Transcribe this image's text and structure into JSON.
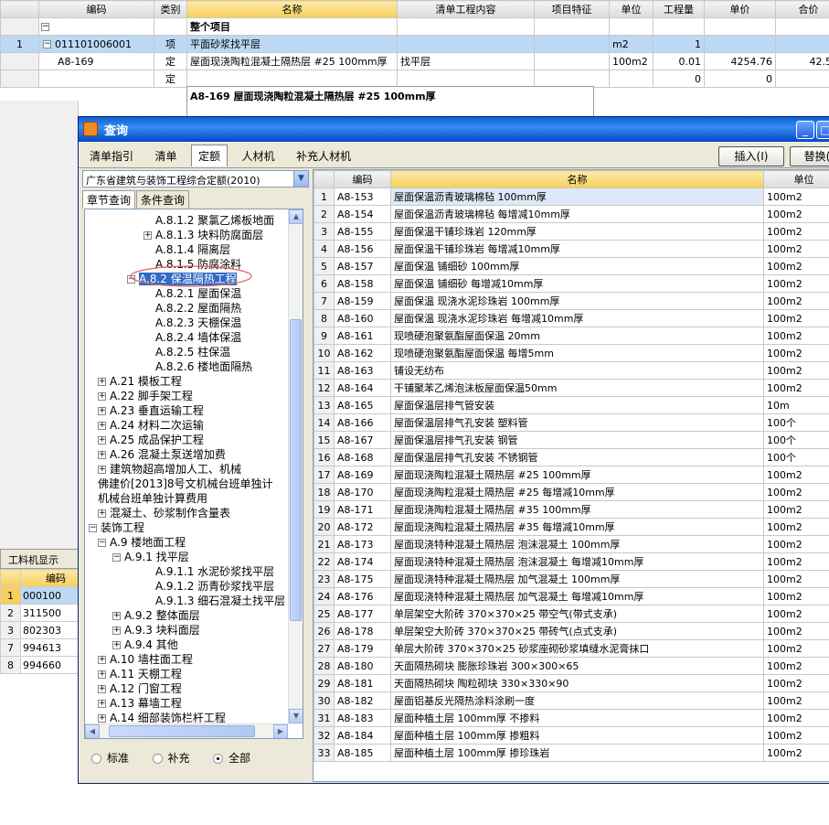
{
  "main_grid": {
    "headers": [
      "编码",
      "类别",
      "名称",
      "清单工程内容",
      "项目特征",
      "单位",
      "工程量",
      "单价",
      "合价"
    ],
    "rows": [
      {
        "rn": "",
        "expand": "−",
        "code": "",
        "type": "",
        "name": "整个项目",
        "content": "",
        "feature": "",
        "unit": "",
        "qty": "",
        "price": "",
        "total": ""
      },
      {
        "rn": "1",
        "expand": "−",
        "code": "011101006001",
        "type": "项",
        "name": "平面砂浆找平层",
        "content": "",
        "feature": "",
        "unit": "m2",
        "qty": "1",
        "price": "",
        "total": ""
      },
      {
        "rn": "",
        "expand": "",
        "code": "A8-169",
        "type": "定",
        "name": "屋面现浇陶粒混凝土隔热层 #25 100mm厚",
        "content": "找平层",
        "feature": "",
        "unit": "100m2",
        "qty": "0.01",
        "price": "4254.76",
        "total": "42.55"
      },
      {
        "rn": "",
        "expand": "",
        "code": "",
        "type": "定",
        "name": "",
        "content": "",
        "feature": "",
        "unit": "",
        "qty": "0",
        "price": "0",
        "total": "0"
      }
    ],
    "tooltip": "A8-169 屋面现浇陶粒混凝土隔热层 #25 100mm厚"
  },
  "gongliao": {
    "tab": "工料机显示",
    "header": "编码",
    "rows": [
      {
        "rn": "1",
        "code": "000100"
      },
      {
        "rn": "2",
        "code": "311500"
      },
      {
        "rn": "3",
        "code": "802303"
      },
      {
        "rn": "7",
        "code": "994613"
      },
      {
        "rn": "8",
        "code": "994660"
      }
    ]
  },
  "dialog": {
    "title": "查询",
    "tabs": [
      "清单指引",
      "清单",
      "定额",
      "人材机",
      "补充人材机"
    ],
    "insert_label": "插入(I)",
    "replace_label": "替换(",
    "quota_lib": "广东省建筑与装饰工程综合定额(2010)",
    "subtabs": [
      "章节查询",
      "条件查询"
    ],
    "tree": [
      {
        "text": "A.8.1.2 聚氯乙烯板地面",
        "indent": 4,
        "pm": ""
      },
      {
        "text": "A.8.1.3 块料防腐面层",
        "indent": 4,
        "pm": "+"
      },
      {
        "text": "A.8.1.4 隔离层",
        "indent": 4,
        "pm": ""
      },
      {
        "text": "A.8.1.5 防腐涂料",
        "indent": 4,
        "pm": ""
      },
      {
        "text": "A.8.2 保温隔热工程",
        "indent": 3,
        "pm": "−",
        "selected": true
      },
      {
        "text": "A.8.2.1 屋面保温",
        "indent": 4,
        "pm": ""
      },
      {
        "text": "A.8.2.2 屋面隔热",
        "indent": 4,
        "pm": ""
      },
      {
        "text": "A.8.2.3 天棚保温",
        "indent": 4,
        "pm": ""
      },
      {
        "text": "A.8.2.4 墙体保温",
        "indent": 4,
        "pm": ""
      },
      {
        "text": "A.8.2.5 柱保温",
        "indent": 4,
        "pm": ""
      },
      {
        "text": "A.8.2.6 楼地面隔热",
        "indent": 4,
        "pm": ""
      },
      {
        "text": "A.21 模板工程",
        "indent": 1,
        "pm": "+"
      },
      {
        "text": "A.22 脚手架工程",
        "indent": 1,
        "pm": "+"
      },
      {
        "text": "A.23 垂直运输工程",
        "indent": 1,
        "pm": "+"
      },
      {
        "text": "A.24 材料二次运输",
        "indent": 1,
        "pm": "+"
      },
      {
        "text": "A.25 成品保护工程",
        "indent": 1,
        "pm": "+"
      },
      {
        "text": "A.26 混凝土泵送增加费",
        "indent": 1,
        "pm": "+"
      },
      {
        "text": "建筑物超高增加人工、机械",
        "indent": 1,
        "pm": "+"
      },
      {
        "text": "佛建价[2013]8号文机械台班单独计",
        "indent": 1,
        "pm": "",
        "nobox": true
      },
      {
        "text": "机械台班单独计算费用",
        "indent": 1,
        "pm": "",
        "nobox": true
      },
      {
        "text": "混凝土、砂浆制作含量表",
        "indent": 1,
        "pm": "+"
      },
      {
        "text": "装饰工程",
        "indent": 0,
        "pm": "−"
      },
      {
        "text": "A.9 楼地面工程",
        "indent": 1,
        "pm": "−"
      },
      {
        "text": "A.9.1 找平层",
        "indent": 2,
        "pm": "−"
      },
      {
        "text": "A.9.1.1 水泥砂浆找平层",
        "indent": 4,
        "pm": ""
      },
      {
        "text": "A.9.1.2 沥青砂浆找平层",
        "indent": 4,
        "pm": ""
      },
      {
        "text": "A.9.1.3 细石混凝土找平层",
        "indent": 4,
        "pm": ""
      },
      {
        "text": "A.9.2 整体面层",
        "indent": 2,
        "pm": "+"
      },
      {
        "text": "A.9.3 块料面层",
        "indent": 2,
        "pm": "+"
      },
      {
        "text": "A.9.4 其他",
        "indent": 2,
        "pm": "+"
      },
      {
        "text": "A.10 墙柱面工程",
        "indent": 1,
        "pm": "+"
      },
      {
        "text": "A.11 天棚工程",
        "indent": 1,
        "pm": "+"
      },
      {
        "text": "A.12 门窗工程",
        "indent": 1,
        "pm": "+"
      },
      {
        "text": "A.13 幕墙工程",
        "indent": 1,
        "pm": "+"
      },
      {
        "text": "A.14 细部装饰栏杆工程",
        "indent": 1,
        "pm": "+"
      }
    ],
    "radios": [
      {
        "label": "标准",
        "on": false
      },
      {
        "label": "补充",
        "on": false
      },
      {
        "label": "全部",
        "on": true
      }
    ],
    "grid": {
      "headers": [
        "",
        "编码",
        "名称",
        "单位"
      ],
      "rows": [
        [
          "1",
          "A8-153",
          "屋面保温沥青玻璃棉毡 100mm厚",
          "100m2"
        ],
        [
          "2",
          "A8-154",
          "屋面保温沥青玻璃棉毡 每增减10mm厚",
          "100m2"
        ],
        [
          "3",
          "A8-155",
          "屋面保温干铺珍珠岩 120mm厚",
          "100m2"
        ],
        [
          "4",
          "A8-156",
          "屋面保温干铺珍珠岩 每增减10mm厚",
          "100m2"
        ],
        [
          "5",
          "A8-157",
          "屋面保温 铺细砂 100mm厚",
          "100m2"
        ],
        [
          "6",
          "A8-158",
          "屋面保温 铺细砂 每增减10mm厚",
          "100m2"
        ],
        [
          "7",
          "A8-159",
          "屋面保温 现浇水泥珍珠岩 100mm厚",
          "100m2"
        ],
        [
          "8",
          "A8-160",
          "屋面保温 现浇水泥珍珠岩 每增减10mm厚",
          "100m2"
        ],
        [
          "9",
          "A8-161",
          "现喷硬泡聚氨酯屋面保温 20mm",
          "100m2"
        ],
        [
          "10",
          "A8-162",
          "现喷硬泡聚氨酯屋面保温 每增5mm",
          "100m2"
        ],
        [
          "11",
          "A8-163",
          "铺设无纺布",
          "100m2"
        ],
        [
          "12",
          "A8-164",
          "干铺聚苯乙烯泡沫板屋面保温50mm",
          "100m2"
        ],
        [
          "13",
          "A8-165",
          "屋面保温层排气管安装",
          "10m"
        ],
        [
          "14",
          "A8-166",
          "屋面保温层排气孔安装 塑料管",
          "100个"
        ],
        [
          "15",
          "A8-167",
          "屋面保温层排气孔安装 钢管",
          "100个"
        ],
        [
          "16",
          "A8-168",
          "屋面保温层排气孔安装 不锈钢管",
          "100个"
        ],
        [
          "17",
          "A8-169",
          "屋面现浇陶粒混凝土隔热层 #25 100mm厚",
          "100m2"
        ],
        [
          "18",
          "A8-170",
          "屋面现浇陶粒混凝土隔热层 #25 每增减10mm厚",
          "100m2"
        ],
        [
          "19",
          "A8-171",
          "屋面现浇陶粒混凝土隔热层 #35 100mm厚",
          "100m2"
        ],
        [
          "20",
          "A8-172",
          "屋面现浇陶粒混凝土隔热层 #35 每增减10mm厚",
          "100m2"
        ],
        [
          "21",
          "A8-173",
          "屋面现浇特种混凝土隔热层 泡沫混凝土 100mm厚",
          "100m2"
        ],
        [
          "22",
          "A8-174",
          "屋面现浇特种混凝土隔热层 泡沫混凝土 每增减10mm厚",
          "100m2"
        ],
        [
          "23",
          "A8-175",
          "屋面现浇特种混凝土隔热层 加气混凝土 100mm厚",
          "100m2"
        ],
        [
          "24",
          "A8-176",
          "屋面现浇特种混凝土隔热层 加气混凝土 每增减10mm厚",
          "100m2"
        ],
        [
          "25",
          "A8-177",
          "单层架空大阶砖 370×370×25 带空气(带式支承)",
          "100m2"
        ],
        [
          "26",
          "A8-178",
          "单层架空大阶砖 370×370×25 带砖气(点式支承)",
          "100m2"
        ],
        [
          "27",
          "A8-179",
          "单层大阶砖 370×370×25 砂浆座砌砂浆填缝水泥膏抹口",
          "100m2"
        ],
        [
          "28",
          "A8-180",
          "天面隔热砌块 膨胀珍珠岩 300×300×65",
          "100m2"
        ],
        [
          "29",
          "A8-181",
          "天面隔热砌块 陶粒砌块 330×330×90",
          "100m2"
        ],
        [
          "30",
          "A8-182",
          "屋面铝基反光隔热涂料涂刷一度",
          "100m2"
        ],
        [
          "31",
          "A8-183",
          "屋面种植土层 100mm厚 不掺料",
          "100m2"
        ],
        [
          "32",
          "A8-184",
          "屋面种植土层 100mm厚 掺粗料",
          "100m2"
        ],
        [
          "33",
          "A8-185",
          "屋面种植土层 100mm厚 掺珍珠岩",
          "100m2"
        ]
      ]
    }
  }
}
